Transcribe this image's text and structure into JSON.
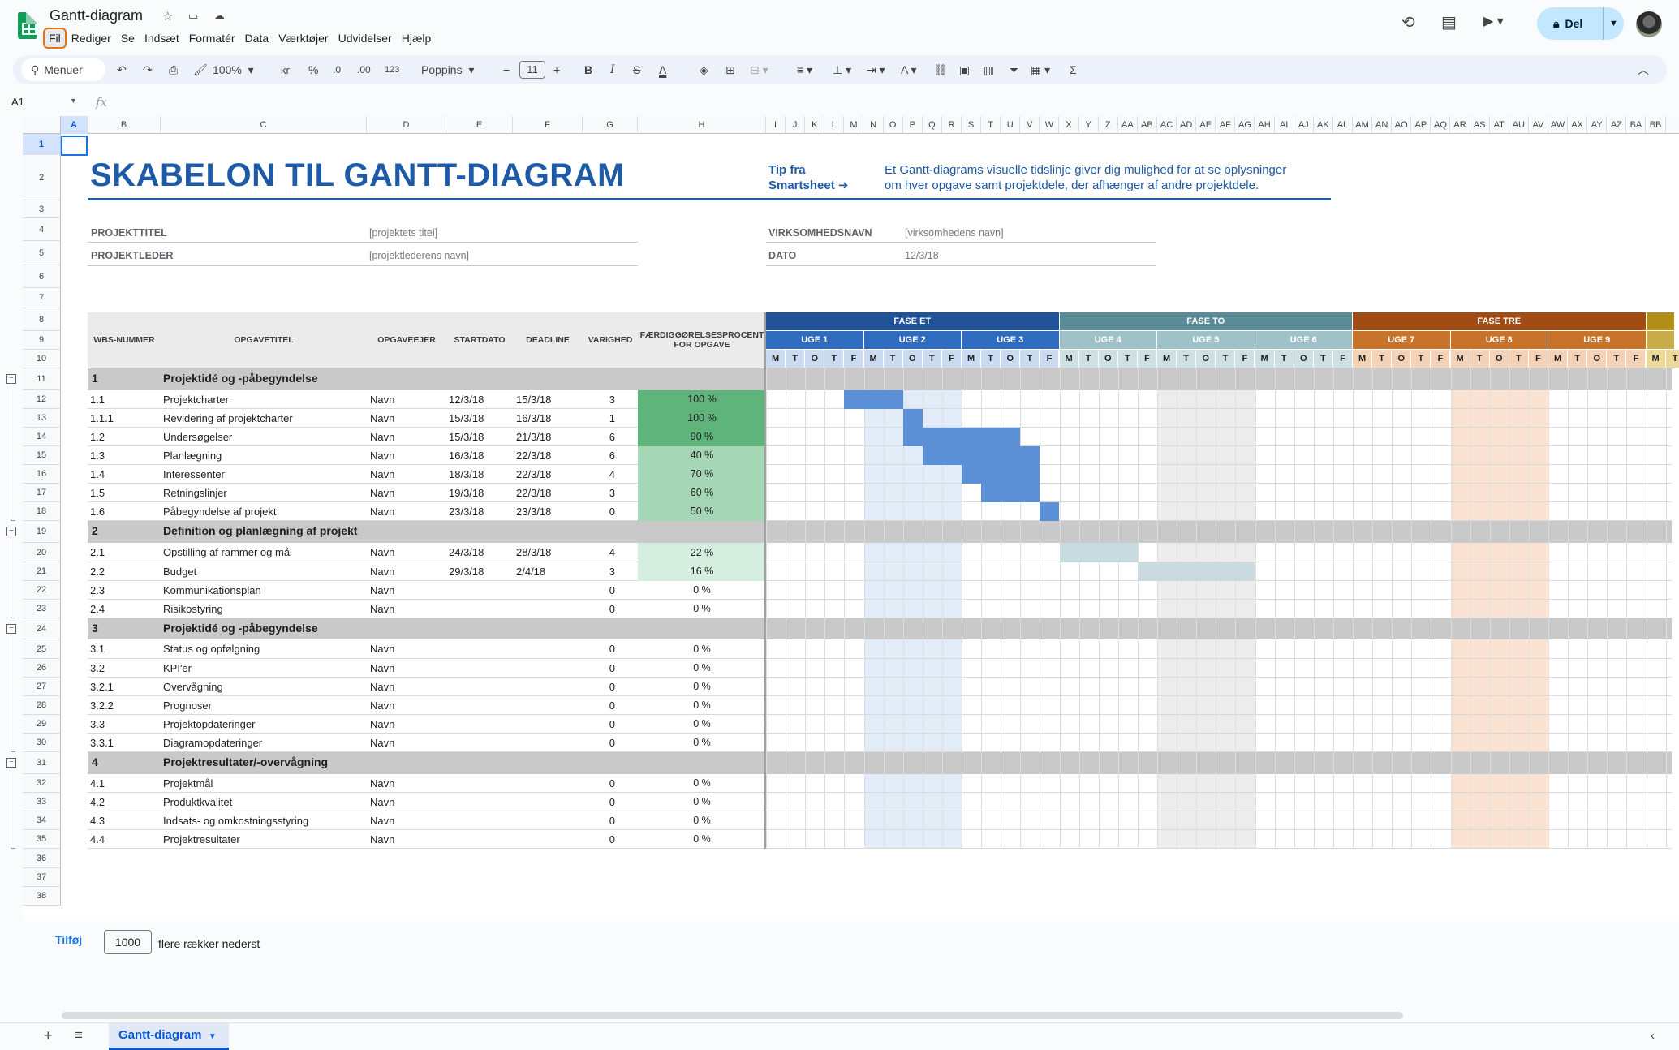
{
  "doc": {
    "title": "Gantt-diagram"
  },
  "menu": [
    "Fil",
    "Rediger",
    "Se",
    "Indsæt",
    "Formatér",
    "Data",
    "Værktøjer",
    "Udvidelser",
    "Hjælp"
  ],
  "share": {
    "label": "Del"
  },
  "toolbar": {
    "search": "Menuer",
    "zoom": "100%",
    "currency": "kr",
    "percent": "%",
    "dec_less": ".0",
    "dec_more": ".00",
    "format_123": "123",
    "font": "Poppins",
    "font_size": "11"
  },
  "formula_bar": {
    "name_box": "A1",
    "fx": "fx"
  },
  "columns": [
    "A",
    "B",
    "C",
    "D",
    "E",
    "F",
    "G",
    "H",
    "I",
    "J",
    "K",
    "L",
    "M",
    "N",
    "O",
    "P",
    "Q",
    "R",
    "S",
    "T",
    "U",
    "V",
    "W",
    "X",
    "Y",
    "Z",
    "AA",
    "AB",
    "AC",
    "AD",
    "AE",
    "AF",
    "AG",
    "AH",
    "AI",
    "AJ",
    "AK",
    "AL",
    "AM",
    "AN",
    "AO",
    "AP",
    "AQ",
    "AR",
    "AS",
    "AT",
    "AU",
    "AV",
    "AW",
    "AX",
    "AY",
    "AZ",
    "BA",
    "BB"
  ],
  "rows": [
    "1",
    "2",
    "3",
    "4",
    "5",
    "6",
    "7",
    "8",
    "9",
    "10",
    "11",
    "12",
    "13",
    "14",
    "15",
    "16",
    "17",
    "18",
    "19",
    "20",
    "21",
    "22",
    "23",
    "24",
    "25",
    "26",
    "27",
    "28",
    "29",
    "30",
    "31",
    "32",
    "33",
    "34",
    "35",
    "36",
    "37",
    "38"
  ],
  "sheet": {
    "title": "SKABELON TIL GANTT-DIAGRAM",
    "tip_label_1": "Tip fra",
    "tip_label_2": "Smartsheet ➜",
    "tip_text_1": "Et Gantt-diagrams visuelle tidslinje giver dig mulighed for at se oplysninger",
    "tip_text_2": "om hver opgave samt projektdele, der afhænger af andre projektdele.",
    "project_title_label": "PROJEKTTITEL",
    "project_title_value": "[projektets titel]",
    "project_lead_label": "PROJEKTLEDER",
    "project_lead_value": "[projektlederens navn]",
    "company_label": "VIRKSOMHEDSNAVN",
    "company_value": "[virksomhedens navn]",
    "date_label": "DATO",
    "date_value": "12/3/18",
    "headers": {
      "wbs": "WBS-NUMMER",
      "task": "OPGAVETITEL",
      "owner": "OPGAVEEJER",
      "start": "STARTDATO",
      "deadline": "DEADLINE",
      "duration": "VARIGHED",
      "pct_1": "FÆRDIGGØRELSESPROCENT",
      "pct_2": "FOR OPGAVE"
    },
    "phases": [
      "FASE ET",
      "FASE TO",
      "FASE TRE"
    ],
    "weeks": [
      "UGE 1",
      "UGE 2",
      "UGE 3",
      "UGE 4",
      "UGE 5",
      "UGE 6",
      "UGE 7",
      "UGE 8",
      "UGE 9"
    ],
    "days": [
      "M",
      "T",
      "O",
      "T",
      "F"
    ]
  },
  "tasks": [
    {
      "type": "section",
      "wbs": "1",
      "title": "Projektidé og -påbegyndelse"
    },
    {
      "type": "task",
      "wbs": "1.1",
      "title": "Projektcharter",
      "owner": "Navn",
      "start": "12/3/18",
      "deadline": "15/3/18",
      "dur": "3",
      "pct": "100 %",
      "level": 4
    },
    {
      "type": "task",
      "wbs": "1.1.1",
      "title": "Revidering af projektcharter",
      "owner": "Navn",
      "start": "15/3/18",
      "deadline": "16/3/18",
      "dur": "1",
      "pct": "100 %",
      "level": 4
    },
    {
      "type": "task",
      "wbs": "1.2",
      "title": "Undersøgelser",
      "owner": "Navn",
      "start": "15/3/18",
      "deadline": "21/3/18",
      "dur": "6",
      "pct": "90 %",
      "level": 3
    },
    {
      "type": "task",
      "wbs": "1.3",
      "title": "Planlægning",
      "owner": "Navn",
      "start": "16/3/18",
      "deadline": "22/3/18",
      "dur": "6",
      "pct": "40 %",
      "level": 1
    },
    {
      "type": "task",
      "wbs": "1.4",
      "title": "Interessenter",
      "owner": "Navn",
      "start": "18/3/18",
      "deadline": "22/3/18",
      "dur": "4",
      "pct": "70 %",
      "level": 2
    },
    {
      "type": "task",
      "wbs": "1.5",
      "title": "Retningslinjer",
      "owner": "Navn",
      "start": "19/3/18",
      "deadline": "22/3/18",
      "dur": "3",
      "pct": "60 %",
      "level": 2
    },
    {
      "type": "task",
      "wbs": "1.6",
      "title": "Påbegyndelse af projekt",
      "owner": "Navn",
      "start": "23/3/18",
      "deadline": "23/3/18",
      "dur": "0",
      "pct": "50 %",
      "level": 1
    },
    {
      "type": "section",
      "wbs": "2",
      "title": "Definition og planlægning af projekt"
    },
    {
      "type": "task",
      "wbs": "2.1",
      "title": "Opstilling af rammer og mål",
      "owner": "Navn",
      "start": "24/3/18",
      "deadline": "28/3/18",
      "dur": "4",
      "pct": "22 %",
      "level": 0.5
    },
    {
      "type": "task",
      "wbs": "2.2",
      "title": "Budget",
      "owner": "Navn",
      "start": "29/3/18",
      "deadline": "2/4/18",
      "dur": "3",
      "pct": "16 %",
      "level": 0.5
    },
    {
      "type": "task",
      "wbs": "2.3",
      "title": "Kommunikationsplan",
      "owner": "Navn",
      "start": "",
      "deadline": "",
      "dur": "0",
      "pct": "0 %",
      "level": 0
    },
    {
      "type": "task",
      "wbs": "2.4",
      "title": "Risikostyring",
      "owner": "Navn",
      "start": "",
      "deadline": "",
      "dur": "0",
      "pct": "0 %",
      "level": 0
    },
    {
      "type": "section",
      "wbs": "3",
      "title": "Projektidé og -påbegyndelse"
    },
    {
      "type": "task",
      "wbs": "3.1",
      "title": "Status og opfølgning",
      "owner": "Navn",
      "start": "",
      "deadline": "",
      "dur": "0",
      "pct": "0 %",
      "level": 0
    },
    {
      "type": "task",
      "wbs": "3.2",
      "title": "KPI'er",
      "owner": "Navn",
      "start": "",
      "deadline": "",
      "dur": "0",
      "pct": "0 %",
      "level": 0
    },
    {
      "type": "task",
      "wbs": "3.2.1",
      "title": "Overvågning",
      "owner": "Navn",
      "start": "",
      "deadline": "",
      "dur": "0",
      "pct": "0 %",
      "level": 0
    },
    {
      "type": "task",
      "wbs": "3.2.2",
      "title": "Prognoser",
      "owner": "Navn",
      "start": "",
      "deadline": "",
      "dur": "0",
      "pct": "0 %",
      "level": 0
    },
    {
      "type": "task",
      "wbs": "3.3",
      "title": "Projektopdateringer",
      "owner": "Navn",
      "start": "",
      "deadline": "",
      "dur": "0",
      "pct": "0 %",
      "level": 0
    },
    {
      "type": "task",
      "wbs": "3.3.1",
      "title": "Diagramopdateringer",
      "owner": "Navn",
      "start": "",
      "deadline": "",
      "dur": "0",
      "pct": "0 %",
      "level": 0
    },
    {
      "type": "section",
      "wbs": "4",
      "title": "Projektresultater/-overvågning"
    },
    {
      "type": "task",
      "wbs": "4.1",
      "title": "Projektmål",
      "owner": "Navn",
      "start": "",
      "deadline": "",
      "dur": "0",
      "pct": "0 %",
      "level": 0
    },
    {
      "type": "task",
      "wbs": "4.2",
      "title": "Produktkvalitet",
      "owner": "Navn",
      "start": "",
      "deadline": "",
      "dur": "0",
      "pct": "0 %",
      "level": 0
    },
    {
      "type": "task",
      "wbs": "4.3",
      "title": "Indsats- og omkostningsstyring",
      "owner": "Navn",
      "start": "",
      "deadline": "",
      "dur": "0",
      "pct": "0 %",
      "level": 0
    },
    {
      "type": "task",
      "wbs": "4.4",
      "title": "Projektresultater",
      "owner": "Navn",
      "start": "",
      "deadline": "",
      "dur": "0",
      "pct": "0 %",
      "level": 0
    }
  ],
  "gantt_bars": [
    {
      "task": "1.1",
      "day_start": 4,
      "day_end": 6,
      "color": "#5b8fd6"
    },
    {
      "task": "1.1.1",
      "day_start": 7,
      "day_end": 7,
      "color": "#5b8fd6"
    },
    {
      "task": "1.2",
      "day_start": 7,
      "day_end": 12,
      "color": "#5b8fd6"
    },
    {
      "task": "1.3",
      "day_start": 8,
      "day_end": 13,
      "color": "#5b8fd6"
    },
    {
      "task": "1.4",
      "day_start": 10,
      "day_end": 13,
      "color": "#5b8fd6"
    },
    {
      "task": "1.5",
      "day_start": 11,
      "day_end": 13,
      "color": "#5b8fd6"
    },
    {
      "task": "1.6",
      "day_start": 14,
      "day_end": 14,
      "color": "#5b8fd6"
    },
    {
      "task": "2.1",
      "day_start": 15,
      "day_end": 18,
      "color": "#c9dbdf"
    },
    {
      "task": "2.2",
      "day_start": 19,
      "day_end": 24,
      "color": "#c9dbdf"
    }
  ],
  "colors": {
    "phase1": "#1f5296",
    "phase2": "#5a8b96",
    "phase3": "#a24c15",
    "phase4": "#b38f1a",
    "week1": "#2f6cc0",
    "week2": "#9fc1c8",
    "week3": "#c8732a",
    "pct_high": "#5fb47c",
    "pct_mid": "#a5d6b5",
    "pct_low": "#d6eedf",
    "wk2_shade": "#e1ecf8",
    "wk5_shade": "#ececec",
    "wk8_shade": "#fbe3d3",
    "accent": "#1f5aa6"
  },
  "footer": {
    "add_label": "Tilføj",
    "add_count": "1000",
    "add_suffix": "flere rækker nederst",
    "sheet_tab": "Gantt-diagram"
  }
}
